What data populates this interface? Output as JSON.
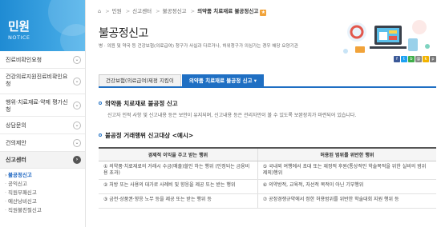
{
  "sidebar": {
    "title": "민원",
    "subtitle": "NOTICE",
    "items": [
      {
        "label": "진료비확인요청"
      },
      {
        "label": "건강의료지원진료비확인요청"
      },
      {
        "label": "행위·치료재료·약제 평가신청"
      },
      {
        "label": "상담문의"
      },
      {
        "label": "건의제안"
      },
      {
        "label": "신고센터"
      }
    ],
    "submenu": [
      {
        "label": "불공정신고"
      },
      {
        "label": "공익신고"
      },
      {
        "label": "직원부패신고"
      },
      {
        "label": "예산낭비신고"
      },
      {
        "label": "직원불친절신고"
      }
    ]
  },
  "breadcrumb": {
    "items": [
      "민원",
      "신고센터",
      "불공정신고",
      "의약품 치료재료 불공정신고"
    ]
  },
  "page": {
    "title": "불공정신고",
    "description": "병 · 의원 및 약국 등 건강보험(의료급여) 청구가 사실과 다르거나, 허위청구가 의심가는 경우 해당 요양기관"
  },
  "tabs": [
    {
      "label": "건강보험(의료급여)제정 지킴이"
    },
    {
      "label": "의약품 치료재료 불공정 신고 ▾"
    }
  ],
  "section1": {
    "heading": "의약품 치료재료 불공정 신고",
    "body": "신고자 인적 사항 및 신고내용 등은 보안이 유지되며, 신고내용 등은 관리자만이 볼 수 있도록 보완장치가 마련되어 있습니다."
  },
  "section2": {
    "heading": "불공정 거래행위 신고대상 <예시>"
  },
  "table": {
    "headers": [
      "경제적 이익을 주고 받는 행위",
      "허용된 범위를 위반한 행위"
    ],
    "rows": [
      [
        "① 의약품·치료재료의 거래시 수금(매출)할인 하는 행위 (인정되는 금융비용 초과)",
        "⑤ 국내외 여행에서 초대 또는 재정적 후원(통상적인 학술목적을 위한 실비의 범위 제외)행위"
      ],
      [
        "② 처방 또는 사용의 대가로 사례비 및 향응을 제공 또는 받는 행위",
        "⑥ 의약방적, 교육적, 자선적 목적이 아닌 기부행위"
      ],
      [
        "③ 금전·상품권·향응 노무 등을 제공 또는 받는 행위 등",
        "⑦ 공정경쟁규약에서 정한 허용범위를 위반한 학술대회 지원 행위 등"
      ]
    ]
  },
  "colors": {
    "brand_blue": "#1f6fc3",
    "sidebar_header": "#2a96dc",
    "favorite_star": "#f1a33a"
  }
}
